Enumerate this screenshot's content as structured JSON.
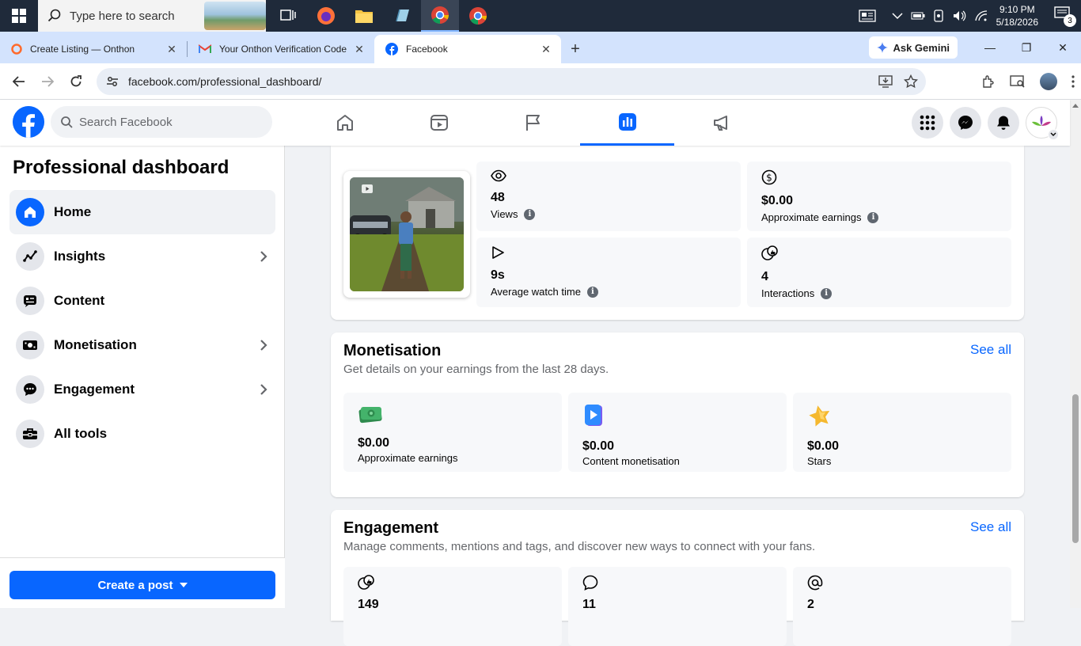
{
  "taskbar": {
    "search_placeholder": "Type here to search",
    "time": "9:10 PM",
    "date": "5/18/2026",
    "notification_count": "3"
  },
  "tabs": [
    {
      "title": "Create Listing — Onthon"
    },
    {
      "title": "Your Onthon Verification Code"
    },
    {
      "title": "Facebook"
    }
  ],
  "browser": {
    "gemini_label": "Ask Gemini",
    "url": "facebook.com/professional_dashboard/"
  },
  "fb": {
    "search_placeholder": "Search Facebook",
    "brand_color": "#0866ff"
  },
  "sidebar": {
    "title": "Professional dashboard",
    "items": [
      {
        "label": "Home"
      },
      {
        "label": "Insights"
      },
      {
        "label": "Content"
      },
      {
        "label": "Monetisation"
      },
      {
        "label": "Engagement"
      },
      {
        "label": "All tools"
      }
    ],
    "create_post": "Create a post"
  },
  "overview": {
    "stats": [
      {
        "value": "48",
        "label": "Views"
      },
      {
        "value": "$0.00",
        "label": "Approximate earnings"
      },
      {
        "value": "9s",
        "label": "Average watch time"
      },
      {
        "value": "4",
        "label": "Interactions"
      }
    ]
  },
  "monetisation": {
    "title": "Monetisation",
    "subtitle": "Get details on your earnings from the last 28 days.",
    "see_all": "See all",
    "tiles": [
      {
        "value": "$0.00",
        "label": "Approximate earnings"
      },
      {
        "value": "$0.00",
        "label": "Content monetisation"
      },
      {
        "value": "$0.00",
        "label": "Stars"
      }
    ]
  },
  "engagement": {
    "title": "Engagement",
    "subtitle": "Manage comments, mentions and tags, and discover new ways to connect with your fans.",
    "see_all": "See all",
    "tiles": [
      {
        "value": "149"
      },
      {
        "value": "11"
      },
      {
        "value": "2"
      }
    ]
  }
}
